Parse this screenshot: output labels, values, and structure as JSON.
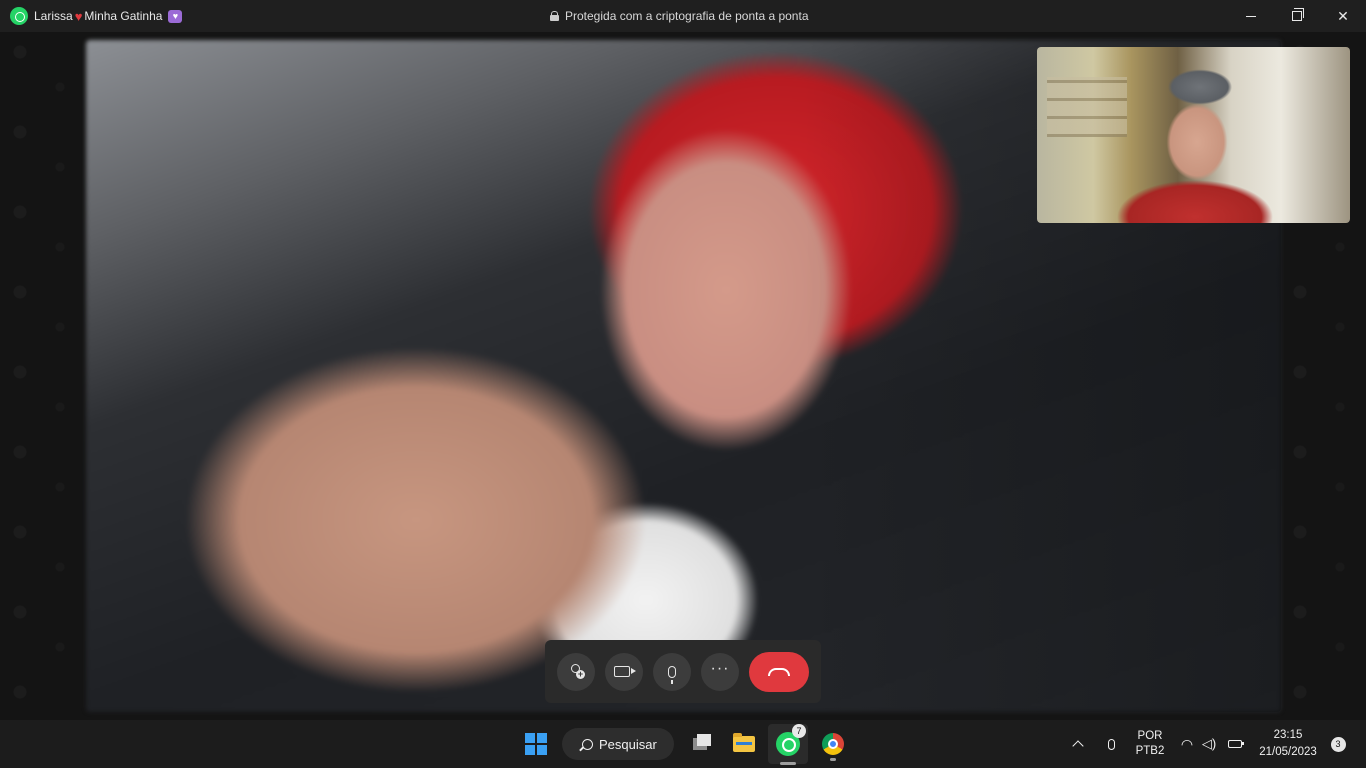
{
  "window": {
    "contact_name": "Larissa",
    "contact_suffix": "Minha Gatinha",
    "encryption_notice": "Protegida com a criptografia de ponta a ponta"
  },
  "call_controls": {
    "add_participant_icon": "add-person-icon",
    "camera_icon": "video-camera-icon",
    "mic_icon": "microphone-icon",
    "more_icon": "more-options-icon",
    "end_call_icon": "hang-up-icon",
    "more_glyph": "···"
  },
  "taskbar": {
    "search_label": "Pesquisar",
    "whatsapp_badge": "7",
    "language_line1": "POR",
    "language_line2": "PTB2",
    "time": "23:15",
    "date": "21/05/2023",
    "notifications_count": "3"
  },
  "colors": {
    "accent_end_call": "#e0393e",
    "whatsapp_green": "#25d366",
    "windows_blue": "#3aa0f3"
  }
}
